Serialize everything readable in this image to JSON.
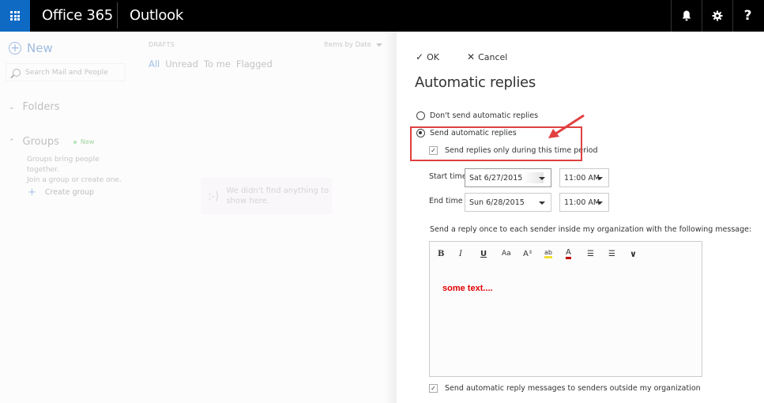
{
  "topbar": {
    "suite": "Office 365",
    "app": "Outlook",
    "icons": [
      "app-launcher-icon",
      "bell-icon",
      "gear-icon",
      "help-icon"
    ],
    "help_glyph": "?",
    "accent_color": "#0f6ac4"
  },
  "sidebar": {
    "new_label": "New",
    "search_placeholder": "Search Mail and People",
    "folders_label": "Folders",
    "groups_label": "Groups",
    "groups_badge": "New",
    "groups_desc_1": "Groups bring people together.",
    "groups_desc_2": "Join a group or create one.",
    "create_group_label": "Create group"
  },
  "list": {
    "folder_name": "DRAFTS",
    "sort_label": "Items by Date",
    "filters": [
      "All",
      "Unread",
      "To me",
      "Flagged"
    ],
    "active_filter": "All",
    "empty_face": ":-)",
    "empty_message_1": "We didn't find anything to",
    "empty_message_2": "show here."
  },
  "panel": {
    "ok_label": "OK",
    "cancel_label": "Cancel",
    "title": "Automatic replies",
    "radio_off_label": "Don't send automatic replies",
    "radio_on_label": "Send automatic replies",
    "radio_selected": "Send automatic replies",
    "time_period_label": "Send replies only during this time period",
    "time_period_checked": true,
    "start_label": "Start time",
    "start_date": "Sat 6/27/2015",
    "start_time": "11:00 AM",
    "end_label": "End time",
    "end_date": "Sun 6/28/2015",
    "end_time": "11:00 AM",
    "message_label": "Send a reply once to each sender inside my organization with the following message:",
    "toolbar": {
      "bold": "B",
      "italic": "I",
      "underline": "U",
      "font_size": "Aa",
      "superscript": "A",
      "highlight": "ab",
      "font_color": "A",
      "bullets": "☰",
      "numbering": "☰",
      "more": "⌄"
    },
    "message_body": "some text....",
    "message_color": "#e00000",
    "outside_label": "Send automatic reply messages to senders outside my organization",
    "outside_checked": true
  },
  "annotation": {
    "highlight_color": "#e04040"
  }
}
